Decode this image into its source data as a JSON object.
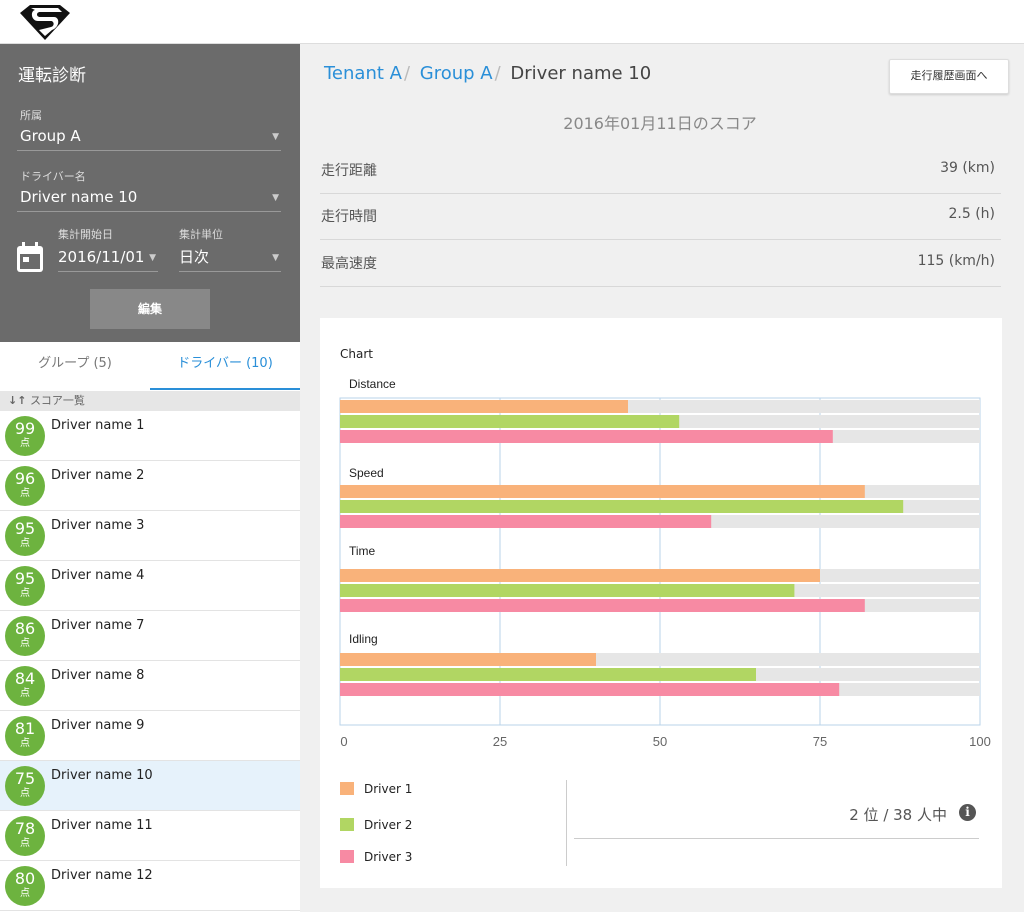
{
  "sidebar": {
    "title": "運転診断",
    "group_label": "所属",
    "group_value": "Group A",
    "driver_label": "ドライバー名",
    "driver_value": "Driver name 10",
    "start_date_label": "集計開始日",
    "start_date_value": "2016/11/01",
    "unit_label": "集計単位",
    "unit_value": "日次",
    "edit_button": "編集",
    "tabs": [
      {
        "label": "グループ (5)"
      },
      {
        "label": "ドライバー (10)"
      }
    ],
    "list_header": "スコア一覧",
    "score_unit": "点",
    "drivers": [
      {
        "score": "99",
        "name": "Driver name 1"
      },
      {
        "score": "96",
        "name": "Driver name 2"
      },
      {
        "score": "95",
        "name": "Driver name 3"
      },
      {
        "score": "95",
        "name": "Driver name 4"
      },
      {
        "score": "86",
        "name": "Driver name 7"
      },
      {
        "score": "84",
        "name": "Driver name 8"
      },
      {
        "score": "81",
        "name": "Driver name 9"
      },
      {
        "score": "75",
        "name": "Driver name 10"
      },
      {
        "score": "78",
        "name": "Driver name 11"
      },
      {
        "score": "80",
        "name": "Driver name 12"
      }
    ]
  },
  "header": {
    "breadcrumb": [
      "Tenant A",
      "Group A",
      "Driver name 10"
    ],
    "history_button": "走行履歴画面へ"
  },
  "main": {
    "score_date": "2016年01月11日のスコア",
    "stats": [
      {
        "label": "走行距離",
        "value": "39 (km)"
      },
      {
        "label": "走行時間",
        "value": "2.5 (h)"
      },
      {
        "label": "最高速度",
        "value": "115 (km/h)"
      }
    ],
    "rank_text": "2 位 / 38 人中",
    "info_glyph": "i"
  },
  "chart_data": {
    "type": "bar",
    "orientation": "horizontal",
    "title": "Chart",
    "categories": [
      "Distance",
      "Speed",
      "Time",
      "Idling"
    ],
    "series": [
      {
        "name": "Driver 1",
        "color": "#f9b27a",
        "values": [
          45,
          82,
          75,
          40
        ]
      },
      {
        "name": "Driver 2",
        "color": "#b1d663",
        "values": [
          53,
          88,
          71,
          65
        ]
      },
      {
        "name": "Driver 3",
        "color": "#f78aa3",
        "values": [
          77,
          58,
          82,
          78
        ]
      }
    ],
    "xlim": [
      0,
      100
    ],
    "xticks": [
      0,
      25,
      50,
      75,
      100
    ],
    "grid": true,
    "legend_position": "bottom-left"
  },
  "colors": {
    "accent": "#2a8fd8",
    "score_badge": "#6db33f",
    "panel": "#6b6b6b"
  }
}
